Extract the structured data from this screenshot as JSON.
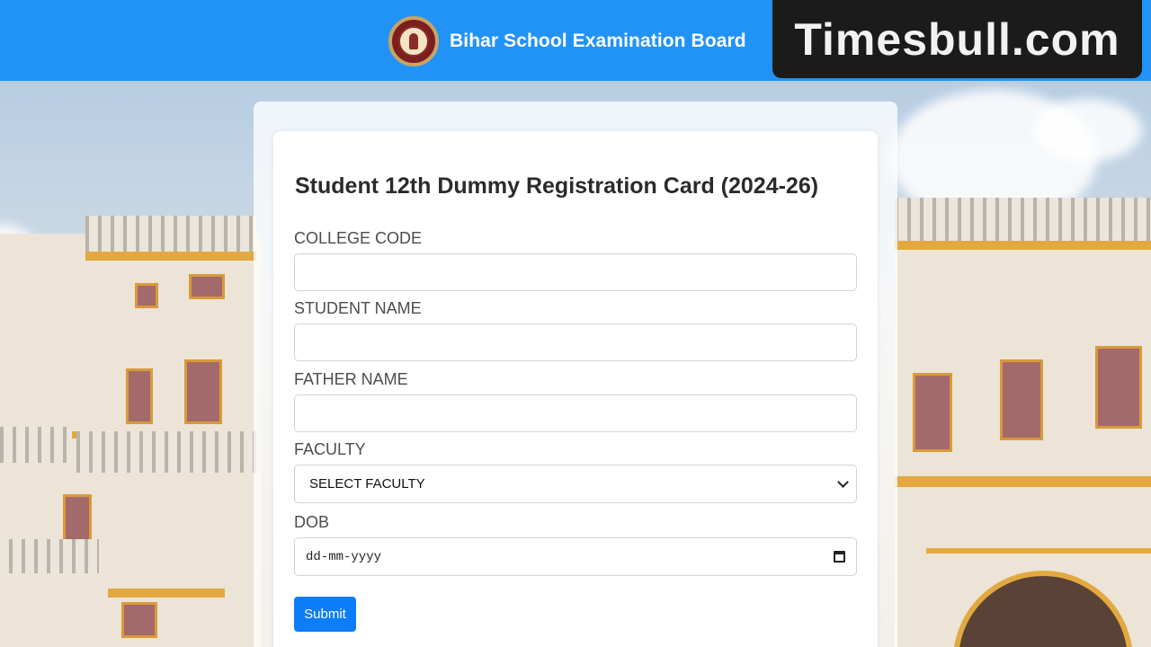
{
  "header": {
    "title": "Bihar School Examination Board",
    "logo": "bseb-emblem",
    "background_color": "#2193f8"
  },
  "watermark": {
    "text": "Timesbull.com"
  },
  "form": {
    "title": "Student 12th Dummy Registration Card (2024-26)",
    "fields": {
      "college_code": {
        "label": "COLLEGE CODE",
        "value": ""
      },
      "student_name": {
        "label": "STUDENT NAME",
        "value": ""
      },
      "father_name": {
        "label": "FATHER NAME",
        "value": ""
      },
      "faculty": {
        "label": "FACULTY",
        "selected": "SELECT FACULTY"
      },
      "dob": {
        "label": "DOB",
        "placeholder": "dd-mm-yyyy"
      }
    },
    "submit_label": "Submit",
    "accent_color": "#0d7df8"
  }
}
